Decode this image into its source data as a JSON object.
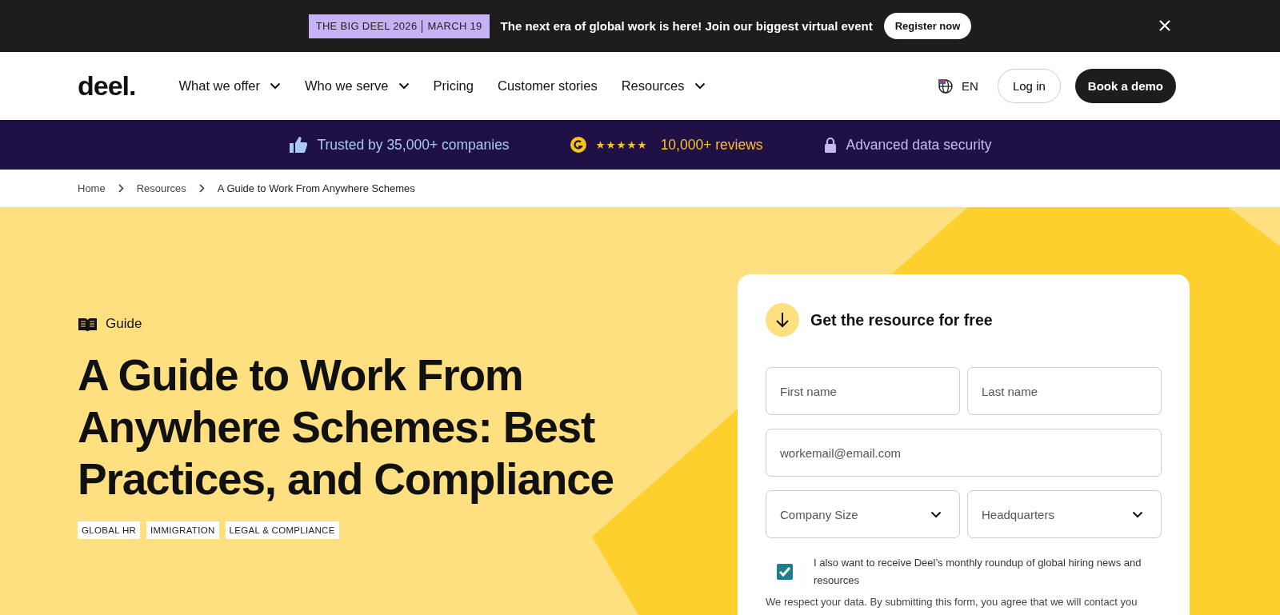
{
  "announcement": {
    "badge_event": "THE BIG DEEL 2026",
    "badge_date": "MARCH 19",
    "message": "The next era of global work is here! Join our biggest virtual event",
    "button": "Register now"
  },
  "nav": {
    "logo": "deel.",
    "items": [
      {
        "label": "What we offer",
        "dropdown": true
      },
      {
        "label": "Who we serve",
        "dropdown": true
      },
      {
        "label": "Pricing",
        "dropdown": false
      },
      {
        "label": "Customer stories",
        "dropdown": false
      },
      {
        "label": "Resources",
        "dropdown": true
      }
    ],
    "language": "EN",
    "login": "Log in",
    "demo": "Book a demo"
  },
  "trust_bar": {
    "companies": "Trusted by 35,000+ companies",
    "stars": 5,
    "reviews": "10,000+ reviews",
    "security": "Advanced data security"
  },
  "breadcrumb": [
    "Home",
    "Resources",
    "A Guide to Work From Anywhere Schemes"
  ],
  "hero": {
    "type_label": "Guide",
    "title": "A Guide to Work From Anywhere Schemes: Best Practices, and Compliance",
    "tags": [
      "GLOBAL HR",
      "IMMIGRATION",
      "LEGAL & COMPLIANCE"
    ]
  },
  "form": {
    "title": "Get the resource for free",
    "fields": [
      {
        "kind": "text",
        "placeholder": "First name"
      },
      {
        "kind": "text",
        "placeholder": "Last name"
      },
      {
        "kind": "email",
        "placeholder": "workemail@email.com"
      },
      {
        "kind": "select",
        "placeholder": "Company Size"
      },
      {
        "kind": "select",
        "placeholder": "Headquarters"
      }
    ],
    "consent": {
      "checked": true,
      "label": "I also want to receive Deel’s monthly roundup of global hiring news and resources"
    },
    "notice": "We respect your data. By submitting this form, you agree that we will contact you"
  }
}
